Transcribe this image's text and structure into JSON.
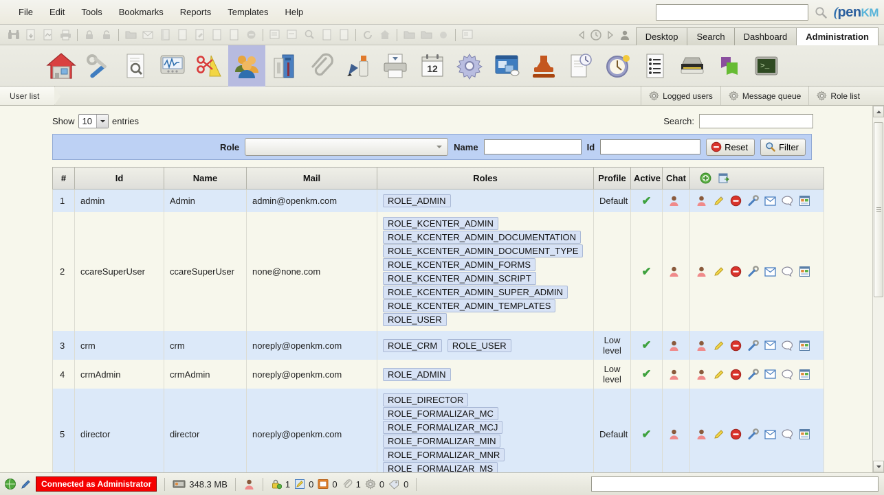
{
  "menu": {
    "items": [
      "File",
      "Edit",
      "Tools",
      "Bookmarks",
      "Reports",
      "Templates",
      "Help"
    ],
    "search_value": "",
    "search_placeholder": "",
    "logo_o": "(",
    "logo_pen": "pen",
    "logo_km": "KM"
  },
  "toolbar": {
    "icons": [
      "binoculars-icon",
      "document-download-icon",
      "document-pdf-icon",
      "print-icon",
      "lock-add-icon",
      "lock-remove-icon",
      "folder-add-icon",
      "mail-add-icon",
      "note-add-icon",
      "document-add-icon",
      "document-edit-icon",
      "document-copy-icon",
      "document-move-icon",
      "remove-icon",
      "properties-icon",
      "properties-edit-icon",
      "find-icon",
      "document-info-icon",
      "document-view-icon",
      "refresh-icon",
      "home-icon",
      "folder-lock-icon",
      "folder-unlock-icon",
      "folder-share-icon",
      "document-list-icon"
    ],
    "nav_back": "nav-back-icon",
    "nav_clock": "nav-history-icon",
    "nav_forward": "nav-forward-icon",
    "nav_user": "nav-user-icon",
    "tabs": [
      {
        "label": "Desktop",
        "active": false
      },
      {
        "label": "Search",
        "active": false
      },
      {
        "label": "Dashboard",
        "active": false
      },
      {
        "label": "Administration",
        "active": true
      }
    ]
  },
  "iconbar": {
    "items": [
      {
        "name": "home-icon",
        "selected": false
      },
      {
        "name": "tools-icon",
        "selected": false
      },
      {
        "name": "document-search-icon",
        "selected": false
      },
      {
        "name": "activity-monitor-icon",
        "selected": false
      },
      {
        "name": "design-tools-icon",
        "selected": false
      },
      {
        "name": "users-icon",
        "selected": true
      },
      {
        "name": "mail-archive-icon",
        "selected": false
      },
      {
        "name": "paperclip-icon",
        "selected": false
      },
      {
        "name": "paint-icon",
        "selected": false
      },
      {
        "name": "printer-icon",
        "selected": false
      },
      {
        "name": "calendar-icon",
        "selected": false
      },
      {
        "name": "gear-icon",
        "selected": false
      },
      {
        "name": "workflow-icon",
        "selected": false
      },
      {
        "name": "stamp-icon",
        "selected": false
      },
      {
        "name": "document-clock-icon",
        "selected": false
      },
      {
        "name": "clock-icon",
        "selected": false
      },
      {
        "name": "list-icon",
        "selected": false
      },
      {
        "name": "scanner-icon",
        "selected": false
      },
      {
        "name": "books-icon",
        "selected": false
      },
      {
        "name": "terminal-icon",
        "selected": false
      }
    ]
  },
  "subnav": {
    "breadcrumb": "User list",
    "buttons": [
      {
        "label": "Logged users",
        "icon": "gear-icon"
      },
      {
        "label": "Message queue",
        "icon": "gear-icon"
      },
      {
        "label": "Role list",
        "icon": "gear-icon"
      }
    ]
  },
  "controls": {
    "show_label": "Show",
    "entries_value": "10",
    "entries_label": "entries",
    "search_label": "Search:",
    "search_value": "",
    "role_label": "Role",
    "role_value": "",
    "name_label": "Name",
    "name_value": "",
    "id_label": "Id",
    "id_value": "",
    "reset_label": "Reset",
    "filter_label": "Filter"
  },
  "table": {
    "columns": [
      "#",
      "Id",
      "Name",
      "Mail",
      "Roles",
      "Profile",
      "Active",
      "Chat",
      ""
    ],
    "header_add_icon": "add-user-icon",
    "header_export_icon": "export-icon",
    "rows": [
      {
        "num": "1",
        "id": "admin",
        "name": "Admin",
        "mail": "admin@openkm.com",
        "roles": [
          "ROLE_ADMIN"
        ],
        "profile": "Default",
        "active": true,
        "chat": true
      },
      {
        "num": "2",
        "id": "ccareSuperUser",
        "name": "ccareSuperUser",
        "mail": "none@none.com",
        "roles": [
          "ROLE_KCENTER_ADMIN",
          "ROLE_KCENTER_ADMIN_DOCUMENTATION",
          "ROLE_KCENTER_ADMIN_DOCUMENT_TYPE",
          "ROLE_KCENTER_ADMIN_FORMS",
          "ROLE_KCENTER_ADMIN_SCRIPT",
          "ROLE_KCENTER_ADMIN_SUPER_ADMIN",
          "ROLE_KCENTER_ADMIN_TEMPLATES",
          "ROLE_USER"
        ],
        "profile": "",
        "active": true,
        "chat": true
      },
      {
        "num": "3",
        "id": "crm",
        "name": "crm",
        "mail": "noreply@openkm.com",
        "roles": [
          "ROLE_CRM",
          "ROLE_USER"
        ],
        "profile": "Low level",
        "active": true,
        "chat": true
      },
      {
        "num": "4",
        "id": "crmAdmin",
        "name": "crmAdmin",
        "mail": "noreply@openkm.com",
        "roles": [
          "ROLE_ADMIN"
        ],
        "profile": "Low level",
        "active": true,
        "chat": true
      },
      {
        "num": "5",
        "id": "director",
        "name": "director",
        "mail": "noreply@openkm.com",
        "roles": [
          "ROLE_DIRECTOR",
          "ROLE_FORMALIZAR_MC",
          "ROLE_FORMALIZAR_MCJ",
          "ROLE_FORMALIZAR_MIN",
          "ROLE_FORMALIZAR_MNR",
          "ROLE_FORMALIZAR_MS"
        ],
        "profile": "Default",
        "active": true,
        "chat": true
      }
    ],
    "row_actions": [
      "user-profile-icon",
      "edit-icon",
      "delete-icon",
      "permissions-icon",
      "mail-icon",
      "chat-icon",
      "report-icon"
    ]
  },
  "statusbar": {
    "globe_icon": "globe-icon",
    "pencil_icon": "pencil-icon",
    "connection": "Connected as Administrator",
    "memory_icon": "memory-icon",
    "memory": "348.3 MB",
    "user_icon": "user-icon",
    "counters": [
      {
        "icon": "lock-icon",
        "value": "1"
      },
      {
        "icon": "note-edit-icon",
        "value": "0"
      },
      {
        "icon": "mail-unread-icon",
        "value": "0"
      },
      {
        "icon": "paperclip-icon",
        "value": "1"
      },
      {
        "icon": "gear-icon",
        "value": "0"
      },
      {
        "icon": "tag-icon",
        "value": "0"
      }
    ],
    "input_value": ""
  },
  "colors": {
    "accent_selected": "#b7bbe0",
    "filter_bar": "#bdd1f4",
    "row_odd": "#dce9f9",
    "row_even": "#f7f7ec",
    "connected_badge": "#f50000",
    "check_green": "#3fa23f"
  }
}
